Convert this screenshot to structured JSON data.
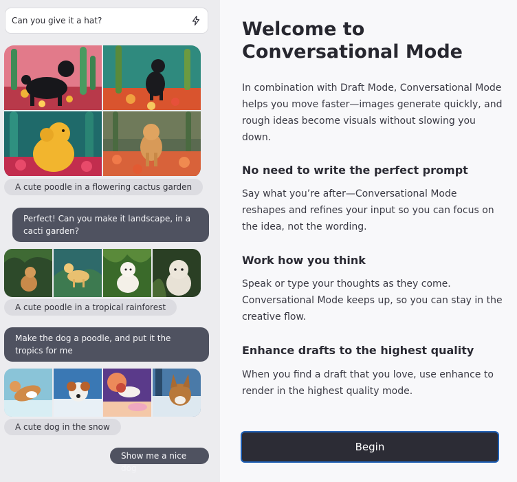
{
  "chat": {
    "prompt_value": "Can you give it a hat?",
    "prompt_icon": "lightning-bolt-icon",
    "caption_1": "A cute poodle in a flowering cactus garden",
    "user_msg_1": "Perfect! Can you make it landscape, in a cacti garden?",
    "caption_2": "A cute poodle in a tropical rainforest",
    "user_msg_2": "Make the dog a poodle, and put it the tropics for me",
    "caption_3": "A cute dog in the snow",
    "user_msg_3": "Show me a nice dog"
  },
  "info": {
    "title": "Welcome to Conversational Mode",
    "intro": "In combination with Draft Mode, Conversational Mode helps you move faster—images generate quickly, and rough ideas become visuals without slowing you down.",
    "section_1_heading": "No need to write the perfect prompt",
    "section_1_body": "Say what you’re after—Conversational Mode reshapes and refines your input so you can focus on the idea, not the wording.",
    "section_2_heading": "Work how you think",
    "section_2_body": "Speak or type your thoughts as they come. Conversational Mode keeps up, so you can stay in the creative flow.",
    "section_3_heading": "Enhance drafts to the highest quality",
    "section_3_body": "When you find a draft that you love, use enhance to render in the highest quality mode.",
    "begin_label": "Begin"
  },
  "colors": {
    "accent_border": "#1f5fb4",
    "button_bg": "#2c2c35",
    "user_bubble": "#4f5260"
  }
}
